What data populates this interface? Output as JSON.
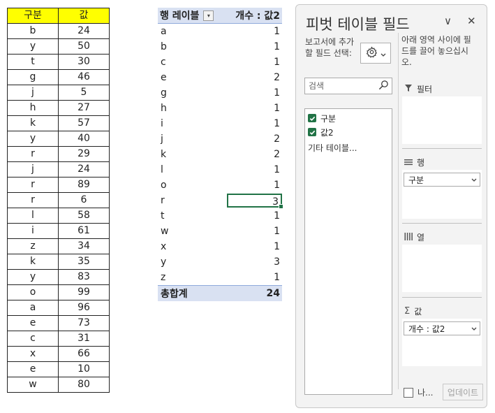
{
  "source_table": {
    "headers": [
      "구분",
      "값"
    ],
    "rows": [
      [
        "b",
        "24"
      ],
      [
        "y",
        "50"
      ],
      [
        "t",
        "30"
      ],
      [
        "g",
        "46"
      ],
      [
        "j",
        "5"
      ],
      [
        "h",
        "27"
      ],
      [
        "k",
        "57"
      ],
      [
        "y",
        "40"
      ],
      [
        "r",
        "29"
      ],
      [
        "j",
        "24"
      ],
      [
        "r",
        "89"
      ],
      [
        "r",
        "6"
      ],
      [
        "l",
        "58"
      ],
      [
        "i",
        "61"
      ],
      [
        "z",
        "34"
      ],
      [
        "k",
        "35"
      ],
      [
        "y",
        "83"
      ],
      [
        "o",
        "99"
      ],
      [
        "a",
        "96"
      ],
      [
        "e",
        "73"
      ],
      [
        "c",
        "31"
      ],
      [
        "x",
        "66"
      ],
      [
        "e",
        "10"
      ],
      [
        "w",
        "80"
      ]
    ]
  },
  "pivot": {
    "row_label_header": "행 레이블",
    "value_header": "개수 : 값2",
    "rows": [
      [
        "a",
        "1"
      ],
      [
        "b",
        "1"
      ],
      [
        "c",
        "1"
      ],
      [
        "e",
        "2"
      ],
      [
        "g",
        "1"
      ],
      [
        "h",
        "1"
      ],
      [
        "i",
        "1"
      ],
      [
        "j",
        "2"
      ],
      [
        "k",
        "2"
      ],
      [
        "l",
        "1"
      ],
      [
        "o",
        "1"
      ],
      [
        "r",
        "3"
      ],
      [
        "t",
        "1"
      ],
      [
        "w",
        "1"
      ],
      [
        "x",
        "1"
      ],
      [
        "y",
        "3"
      ],
      [
        "z",
        "1"
      ]
    ],
    "selected_row": 11,
    "total_label": "총합계",
    "total_value": "24"
  },
  "field_pane": {
    "title": "피벗 테이블 필드",
    "collapse_glyph": "∨",
    "close_glyph": "✕",
    "description_left": "보고서에 추가할 필드 선택:",
    "description_right": "아래 영역 사이에 필드를 끌어 놓으십시오.",
    "search_placeholder": "검색",
    "fields": [
      {
        "name": "구분",
        "checked": true
      },
      {
        "name": "값2",
        "checked": true
      }
    ],
    "more_tables": "기타 테이블...",
    "areas": {
      "filter": {
        "label": "필터"
      },
      "rows": {
        "label": "행",
        "chip": "구분"
      },
      "columns": {
        "label": "열"
      },
      "values": {
        "label": "값",
        "chip": "개수 : 값2"
      }
    },
    "defer_label": "나...",
    "update_button": "업데이트"
  }
}
